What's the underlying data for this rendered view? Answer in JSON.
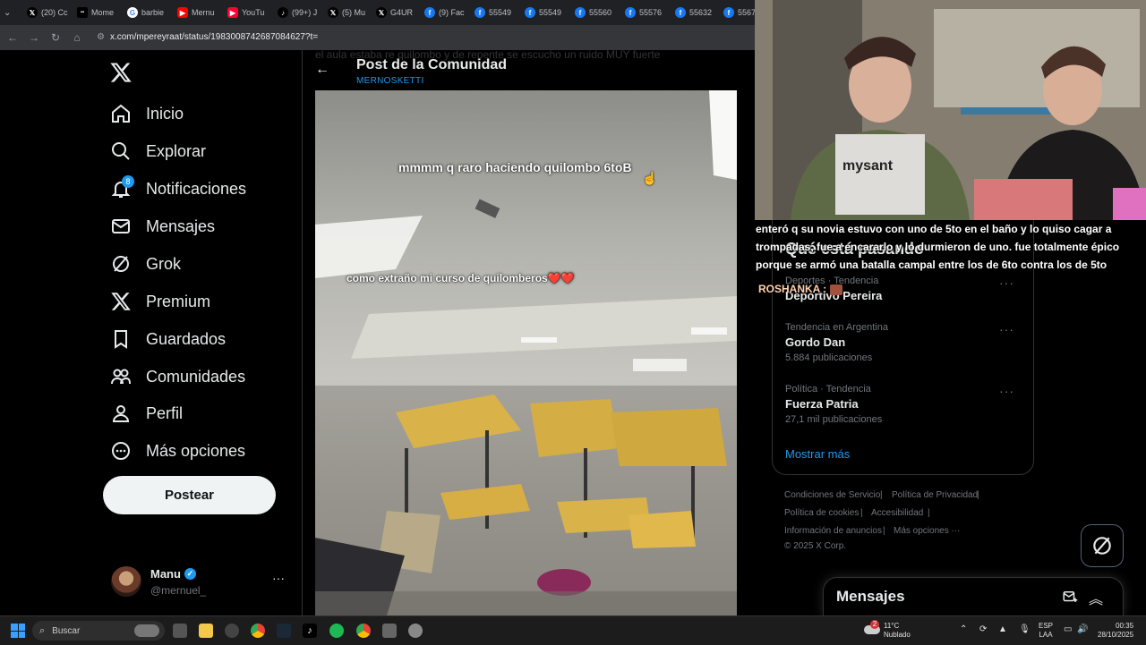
{
  "browser": {
    "tabs": [
      {
        "label": "(20) Cc",
        "icon": "x-icon",
        "color": "#000000"
      },
      {
        "label": "Mome",
        "icon": "bbc-icon",
        "color": "#000000"
      },
      {
        "label": "barbie",
        "icon": "google-icon",
        "color": "#4285f4"
      },
      {
        "label": "Mernu",
        "icon": "youtube-icon",
        "color": "#ff0000"
      },
      {
        "label": "YouTu",
        "icon": "youtube-icon",
        "color": "#ff0033"
      },
      {
        "label": "(99+) J",
        "icon": "tiktok-icon",
        "color": "#000000"
      },
      {
        "label": "(5) Mu",
        "icon": "x-icon",
        "color": "#000000"
      },
      {
        "label": "G4UR",
        "icon": "x-icon",
        "color": "#000000"
      },
      {
        "label": "(9) Fac",
        "icon": "facebook-icon",
        "color": "#1877f2"
      },
      {
        "label": "55549",
        "icon": "facebook-icon",
        "color": "#1877f2"
      },
      {
        "label": "55549",
        "icon": "facebook-icon",
        "color": "#1877f2"
      },
      {
        "label": "55560",
        "icon": "facebook-icon",
        "color": "#1877f2"
      },
      {
        "label": "55576",
        "icon": "facebook-icon",
        "color": "#1877f2"
      },
      {
        "label": "55632",
        "icon": "facebook-icon",
        "color": "#1877f2"
      },
      {
        "label": "5567",
        "icon": "facebook-icon",
        "color": "#1877f2"
      }
    ],
    "url": "x.com/mpereyraat/status/1983008742687084627?t="
  },
  "sidebar": {
    "logo": "X",
    "items": [
      {
        "label": "Inicio",
        "icon": "home-icon"
      },
      {
        "label": "Explorar",
        "icon": "search-icon"
      },
      {
        "label": "Notificaciones",
        "icon": "bell-icon",
        "badge": "8"
      },
      {
        "label": "Mensajes",
        "icon": "mail-icon"
      },
      {
        "label": "Grok",
        "icon": "grok-icon"
      },
      {
        "label": "Premium",
        "icon": "x-icon"
      },
      {
        "label": "Guardados",
        "icon": "bookmark-icon"
      },
      {
        "label": "Comunidades",
        "icon": "people-icon"
      },
      {
        "label": "Perfil",
        "icon": "person-icon"
      },
      {
        "label": "Más opciones",
        "icon": "more-circle-icon"
      }
    ],
    "post_button": "Postear",
    "profile": {
      "name": "Manu",
      "handle": "@mernuel_"
    }
  },
  "post": {
    "title": "Post de la Comunidad",
    "community": "MERNOSKETTI",
    "faint_text": "el aula estaba re quilombo y de repente se escucho un ruido MUY fuerte",
    "video_caption_1": "mmmm q raro haciendo quilombo 6toB",
    "video_caption_2": "como extraño mi curso de quilomberos❤️❤️"
  },
  "stream_chat": {
    "text": "enteró q su novia estuvo con uno de 5to en el baño y lo quiso cagar a trompadas, fue a encararlo y lo durmieron de uno. fue totalmente épico porque se armó una batalla campal entre los de 6to contra los de 5to",
    "user": "ROSHANKA :",
    "hidden_heading": "Qué está pasando"
  },
  "trends": [
    {
      "category": "Deportes · Tendencia",
      "name": "Deportivo Pereira",
      "count": ""
    },
    {
      "category": "Tendencia en Argentina",
      "name": "Gordo Dan",
      "count": "5.884 publicaciones"
    },
    {
      "category": "Política · Tendencia",
      "name": "Fuerza Patria",
      "count": "27,1 mil publicaciones"
    }
  ],
  "show_more": "Mostrar más",
  "footer": {
    "links": [
      "Condiciones de Servicio",
      "Política de Privacidad",
      "Política de cookies",
      "Accesibilidad",
      "Información de anuncios",
      "Más opciones ···"
    ],
    "copyright": "© 2025 X Corp."
  },
  "messages_drawer": {
    "title": "Mensajes"
  },
  "taskbar": {
    "search_placeholder": "Buscar",
    "weather_temp": "11°C",
    "weather_desc": "Nublado",
    "weather_badge": "2",
    "lang_1": "ESP",
    "lang_2": "LAA",
    "time": "00:35",
    "date": "28/10/2025"
  }
}
